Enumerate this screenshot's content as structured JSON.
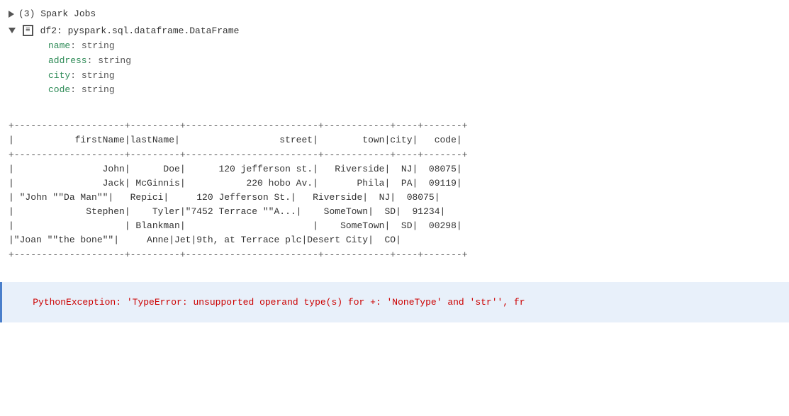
{
  "sparkJobs": {
    "label": "▶  (3) Spark Jobs"
  },
  "schema": {
    "header": "df2: pyspark.sql.dataframe.DataFrame",
    "fields": [
      {
        "name": "name",
        "type": "string"
      },
      {
        "name": "address",
        "type": "string"
      },
      {
        "name": "city",
        "type": "string"
      },
      {
        "name": "code",
        "type": "string"
      }
    ]
  },
  "table": {
    "divider": "+--------------------+---------+--------------------+------------+----+-----+",
    "header": "|           firstName|lastName|              street|        town|city| code|",
    "divider2": "+--------------------+---------+--------------------+------------+----+-----+",
    "rows": [
      "|                John|     Doe|  120 jefferson st.|   Riverside|  NJ|08075|",
      "|                Jack|McGinnis|       220 hobo Av.|       Phila|  PA|09119|",
      "| \"John \"\"Da Man\"\"\"|  Repici| 120 Jefferson St.|   Riverside|  NJ|08075|",
      "|             Stephen|   Tyler|\"7452 Terrace \"\"A...|    SomeTown|  SD|91234|",
      "|                    |Blankman|                   |    SomeTown|  SD|00298|",
      "|\"Joan \"\"the bone\"\"|    Anne|Jet|9th, at Terrace plc|Desert City|  CO|"
    ],
    "divider3": "+--------------------+---------+--------------------+------------+----+-----+"
  },
  "error": {
    "text": "PythonException: 'TypeError: unsupported operand type(s) for +: 'NoneType' and 'str'', fr"
  }
}
